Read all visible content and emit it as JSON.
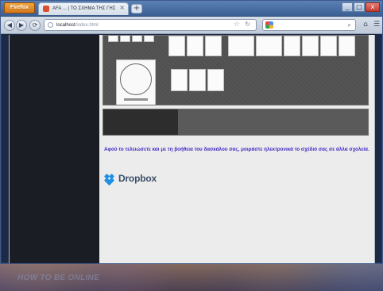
{
  "window": {
    "title": "AFA ... | ΤΟ ΣΧΗΜΑ ΤΗΣ ΓΗΣ",
    "firefox_button": "Firefox",
    "tab_title": "AFA ... | ΤΟ ΣΧΗΜΑ ΤΗΣ ΓΗΣ",
    "controls": {
      "minimize": "_",
      "maximize": "□",
      "close": "x"
    }
  },
  "toolbar": {
    "url_host": "localhost",
    "url_path": "/index.html",
    "search_placeholder": ""
  },
  "content": {
    "instruction": "Αφού το τελειώσετε και με τη βοήθεια του δασκάλου σας, μοιράστε ηλεκτρονικά το σχέδιό σας σε άλλα σχολεία.",
    "brand": "Dropbox"
  },
  "desktop": {
    "watermark": "HOW TO BE ONLINE"
  },
  "icons": {
    "back": "arrow-left-icon",
    "forward": "arrow-right-icon",
    "reload": "reload-icon",
    "home": "home-icon",
    "menu": "menu-icon",
    "search": "search-icon",
    "dropbox": "dropbox-logo-icon"
  },
  "colors": {
    "accent_text": "#3a24c3",
    "dropbox_blue": "#1f8fe5",
    "left_panel": "#1a1d23"
  }
}
